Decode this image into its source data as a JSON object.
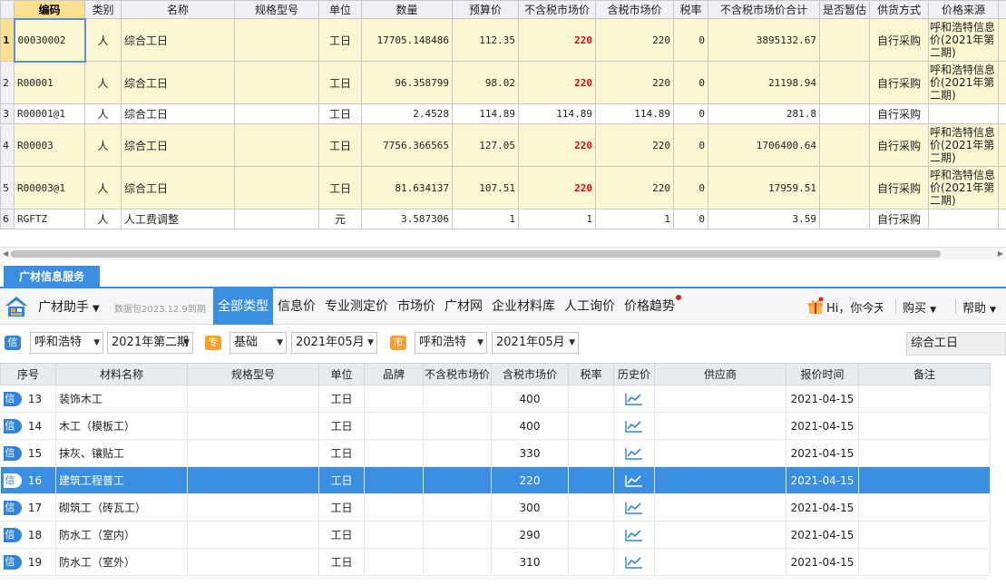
{
  "top_table": {
    "columns": [
      "编码",
      "类别",
      "名称",
      "规格型号",
      "单位",
      "数量",
      "预算价",
      "不含税市场价",
      "含税市场价",
      "税率",
      "不含税市场价合计",
      "是否暂估",
      "供货方式",
      "价格来源"
    ],
    "rows": [
      {
        "rn": "1",
        "code": "00030002",
        "cat": "人",
        "name": "综合工日",
        "spec": "",
        "unit": "工日",
        "qty": "17705.148486",
        "budget": "112.35",
        "mkt_ex": "220",
        "mkt_in": "220",
        "tax": "0",
        "total": "3895132.67",
        "est": "",
        "supply": "自行采购",
        "source": "呼和浩特信息价(2021年第二期)",
        "hl": true,
        "red": true
      },
      {
        "rn": "2",
        "code": "R00001",
        "cat": "人",
        "name": "综合工日",
        "spec": "",
        "unit": "工日",
        "qty": "96.358799",
        "budget": "98.02",
        "mkt_ex": "220",
        "mkt_in": "220",
        "tax": "0",
        "total": "21198.94",
        "est": "",
        "supply": "自行采购",
        "source": "呼和浩特信息价(2021年第二期)",
        "hl": true,
        "red": true
      },
      {
        "rn": "3",
        "code": "R00001@1",
        "cat": "人",
        "name": "综合工日",
        "spec": "",
        "unit": "工日",
        "qty": "2.4528",
        "budget": "114.89",
        "mkt_ex": "114.89",
        "mkt_in": "114.89",
        "tax": "0",
        "total": "281.8",
        "est": "",
        "supply": "自行采购",
        "source": "",
        "hl": false,
        "red": false
      },
      {
        "rn": "4",
        "code": "R00003",
        "cat": "人",
        "name": "综合工日",
        "spec": "",
        "unit": "工日",
        "qty": "7756.366565",
        "budget": "127.05",
        "mkt_ex": "220",
        "mkt_in": "220",
        "tax": "0",
        "total": "1706400.64",
        "est": "",
        "supply": "自行采购",
        "source": "呼和浩特信息价(2021年第二期)",
        "hl": true,
        "red": true
      },
      {
        "rn": "5",
        "code": "R00003@1",
        "cat": "人",
        "name": "综合工日",
        "spec": "",
        "unit": "工日",
        "qty": "81.634137",
        "budget": "107.51",
        "mkt_ex": "220",
        "mkt_in": "220",
        "tax": "0",
        "total": "17959.51",
        "est": "",
        "supply": "自行采购",
        "source": "呼和浩特信息价(2021年第二期)",
        "hl": true,
        "red": true
      },
      {
        "rn": "6",
        "code": "RGFTZ",
        "cat": "人",
        "name": "人工费调整",
        "spec": "",
        "unit": "元",
        "qty": "3.587306",
        "budget": "1",
        "mkt_ex": "1",
        "mkt_in": "1",
        "tax": "0",
        "total": "3.59",
        "est": "",
        "supply": "自行采购",
        "source": "",
        "hl": false,
        "red": false
      }
    ]
  },
  "service_tab": "广材信息服务",
  "toolbar": {
    "assistant": "广材助手",
    "pkg_date": "数据包2023.12.9到期",
    "nav": [
      "全部类型",
      "信息价",
      "专业测定价",
      "市场价",
      "广材网",
      "企业材料库",
      "人工询价",
      "价格趋势"
    ],
    "greeting": "Hi，你今天",
    "buy": "购买",
    "help": "帮助"
  },
  "filters": {
    "tag_info": "信",
    "city1": "呼和浩特",
    "period1": "2021年第二期",
    "tag_spec": "专",
    "base": "基础",
    "month1": "2021年05月",
    "tag_city": "市",
    "city2": "呼和浩特",
    "month2": "2021年05月",
    "search": "综合工日"
  },
  "list": {
    "columns": [
      "序号",
      "材料名称",
      "规格型号",
      "单位",
      "品牌",
      "不含税市场价",
      "含税市场价",
      "税率",
      "历史价",
      "供应商",
      "报价时间",
      "备注"
    ],
    "badge": "信",
    "rows": [
      {
        "seq": "13",
        "name": "装饰木工",
        "spec": "",
        "unit": "工日",
        "brand": "",
        "ex": "",
        "in": "400",
        "tax": "",
        "supplier": "",
        "date": "2021-04-15",
        "note": ""
      },
      {
        "seq": "14",
        "name": "木工（模板工）",
        "spec": "",
        "unit": "工日",
        "brand": "",
        "ex": "",
        "in": "400",
        "tax": "",
        "supplier": "",
        "date": "2021-04-15",
        "note": ""
      },
      {
        "seq": "15",
        "name": "抹灰、镶贴工",
        "spec": "",
        "unit": "工日",
        "brand": "",
        "ex": "",
        "in": "330",
        "tax": "",
        "supplier": "",
        "date": "2021-04-15",
        "note": ""
      },
      {
        "seq": "16",
        "name": "建筑工程普工",
        "spec": "",
        "unit": "工日",
        "brand": "",
        "ex": "",
        "in": "220",
        "tax": "",
        "supplier": "",
        "date": "2021-04-15",
        "note": "",
        "selected": true
      },
      {
        "seq": "17",
        "name": "砌筑工（砖瓦工）",
        "spec": "",
        "unit": "工日",
        "brand": "",
        "ex": "",
        "in": "300",
        "tax": "",
        "supplier": "",
        "date": "2021-04-15",
        "note": ""
      },
      {
        "seq": "18",
        "name": "防水工（室内）",
        "spec": "",
        "unit": "工日",
        "brand": "",
        "ex": "",
        "in": "290",
        "tax": "",
        "supplier": "",
        "date": "2021-04-15",
        "note": ""
      },
      {
        "seq": "19",
        "name": "防水工（室外）",
        "spec": "",
        "unit": "工日",
        "brand": "",
        "ex": "",
        "in": "310",
        "tax": "",
        "supplier": "",
        "date": "2021-04-15",
        "note": ""
      }
    ]
  },
  "colors": {
    "accent": "#3b8fe0",
    "highlight_row": "#fbf7d3",
    "price_red": "#d01010",
    "header_selected": "#f8e08e"
  }
}
